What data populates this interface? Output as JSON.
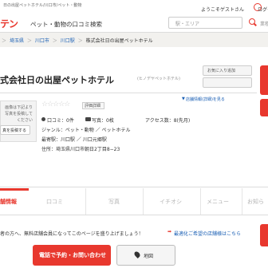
{
  "header": {
    "tagline": "日の出屋ペットホテル/川口市/ペット・動物",
    "logo_text": "テン",
    "site_description": "ペット・動物の口コミ検索",
    "welcome": "ようこそゲストさん",
    "login": "ログイ",
    "search_station_placeholder": "駅・エリア",
    "search_keyword_placeholder": "業種・"
  },
  "breadcrumb": {
    "items": [
      "埼玉県",
      "川口市",
      "川口駅"
    ],
    "current": "株式会社日の出屋ペットホテル"
  },
  "shop": {
    "title": "式会社日の出屋ペットホテル",
    "kana": "(ヒノデヤペットホテル)",
    "favorite_button": "お気に入り追加",
    "nav_button": "",
    "store_info_link": "店舗情報(詳細)を見る",
    "stars": "☆☆☆☆☆",
    "rating_badge": "評価詳細",
    "photo_box_text": "画像は下記より写真を投稿してください",
    "post_photo_button": "真を投稿する",
    "kuchikomi": "口コミ：0件",
    "photo_count": "写真：0枚",
    "access_count": "アクセス数：8(先月)",
    "genre": "ジャンル：ペット・動物 ／ ペットホテル",
    "station": "最寄駅：川口駅 ／ 川口元郷駅",
    "address": "住所：埼玉県川口市朝日2丁目8−23"
  },
  "tabs": {
    "store_info": "舗情報",
    "kuchikomi": "口コミ",
    "photos": "写真",
    "ichioshi": "イチオシ",
    "menu": "メニュー",
    "oshirase": "お知ら"
  },
  "notice": {
    "text": "者の方へ、無料店舗会員になってこのページを盛り上げましょう！",
    "link": "最適化ご希望の店舗様はこちら"
  },
  "actions": {
    "call": "電話で予約・お問い合わせ",
    "map": "地図"
  },
  "colors": {
    "accent": "#e8382e",
    "link": "#1a5fb4",
    "breadcrumb_bg": "#f2f1ee"
  }
}
